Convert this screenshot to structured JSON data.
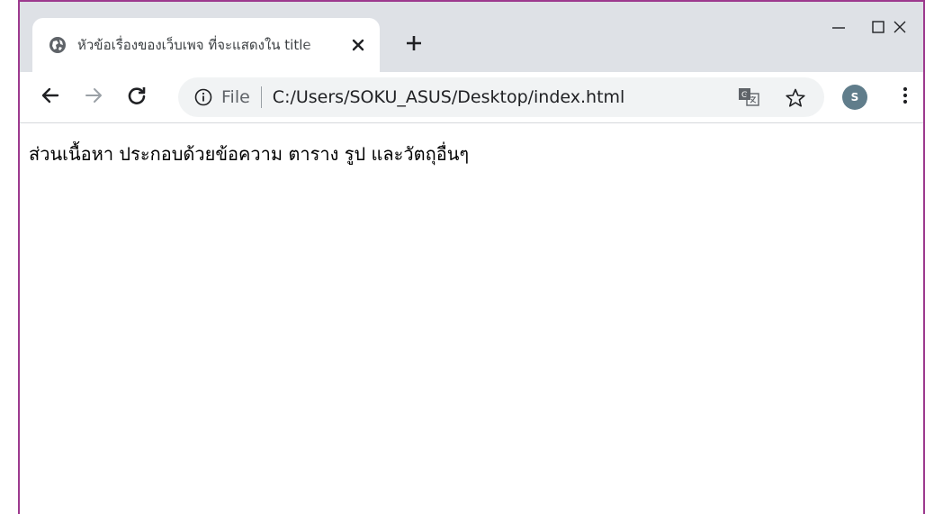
{
  "browser": {
    "tab": {
      "title": "หัวข้อเรื่องของเว็บเพจ ที่จะแสดงใน title",
      "favicon": "globe-icon",
      "close_icon": "close-icon"
    },
    "new_tab_icon": "plus-icon",
    "window_controls": [
      "minimize-icon",
      "maximize-icon",
      "close-icon"
    ],
    "toolbar": {
      "back_icon": "arrow-left-icon",
      "forward_icon": "arrow-right-icon",
      "reload_icon": "reload-icon",
      "info_icon": "info-icon",
      "url_scheme_label": "File",
      "url": "C:/Users/SOKU_ASUS/Desktop/index.html",
      "translate_icon": "translate-icon",
      "bookmark_icon": "star-icon",
      "profile_initial": "S",
      "menu_icon": "kebab-menu-icon"
    }
  },
  "page": {
    "body_text": "ส่วนเนื้อหา ประกอบด้วยข้อความ ตาราง รูป และวัตถุอื่นๆ"
  },
  "colors": {
    "titlebar": "#dee1e6",
    "window_border": "#9d3a8e",
    "avatar": "#607d8b",
    "omnibox": "#f1f3f4"
  }
}
